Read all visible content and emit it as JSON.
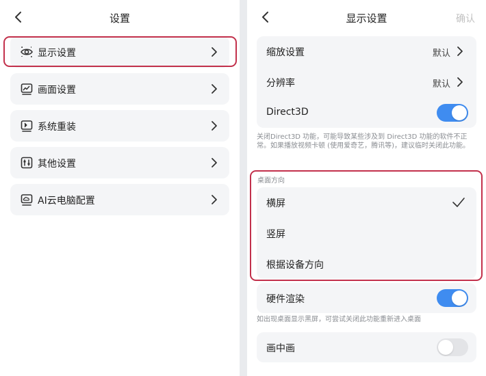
{
  "left": {
    "header": {
      "title": "设置"
    },
    "menu": [
      {
        "label": "显示设置",
        "icon": "eye-icon"
      },
      {
        "label": "画面设置",
        "icon": "picture-icon"
      },
      {
        "label": "系统重装",
        "icon": "system-reinstall-icon"
      },
      {
        "label": "其他设置",
        "icon": "sliders-icon"
      },
      {
        "label": "AI云电脑配置",
        "icon": "cloud-computer-icon"
      }
    ],
    "highlighted_item": "显示设置"
  },
  "right": {
    "header": {
      "title": "显示设置",
      "confirm": "确认"
    },
    "scale": {
      "label": "缩放设置",
      "value": "默认"
    },
    "resolution": {
      "label": "分辨率",
      "value": "默认"
    },
    "direct3d": {
      "label": "Direct3D",
      "enabled": true
    },
    "direct3d_note": "关闭Direct3D 功能，可能导致某些涉及到 Direct3D 功能的软件不正常。如果播放视频卡顿 (使用爱奇艺，腾讯等)，建议临时关闭此功能。",
    "orientation": {
      "section_label": "桌面方向",
      "options": [
        "横屏",
        "竖屏",
        "根据设备方向"
      ],
      "selected": "横屏"
    },
    "hardware_render": {
      "label": "硬件渲染",
      "enabled": true
    },
    "hardware_note": "如出现桌面显示黑屏，可尝试关闭此功能重新进入桌面",
    "pip": {
      "label": "画中画",
      "enabled": false
    }
  },
  "colors": {
    "accent": "#3f8cf0",
    "highlight": "#c2304b",
    "card_bg": "#f4f5f7",
    "muted_text": "#8a8d92",
    "confirm_disabled": "#c2c2c2"
  }
}
